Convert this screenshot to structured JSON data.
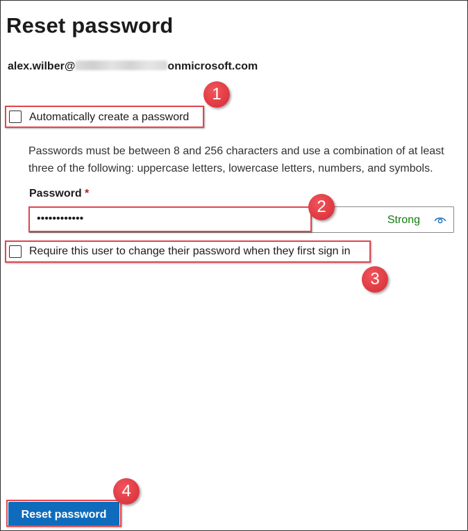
{
  "panel": {
    "title": "Reset password",
    "user_prefix": "alex.wilber@",
    "user_suffix": "onmicrosoft.com"
  },
  "auto_create": {
    "label": "Automatically create a password",
    "checked": false
  },
  "help_text": "Passwords must be between 8 and 256 characters and use a combination of at least three of the following: uppercase letters, lowercase letters, numbers, and symbols.",
  "password": {
    "label": "Password",
    "required_marker": "*",
    "masked_value": "••••••••••••",
    "strength": "Strong",
    "reveal_icon": "eye-icon"
  },
  "require_change": {
    "label": "Require this user to change their password when they first sign in",
    "checked": false
  },
  "actions": {
    "reset_label": "Reset password"
  },
  "callouts": [
    "1",
    "2",
    "3",
    "4"
  ],
  "colors": {
    "accent": "#0f6cbd",
    "callout": "#e13b43",
    "strength_ok": "#107c10",
    "required": "#a4262c"
  }
}
